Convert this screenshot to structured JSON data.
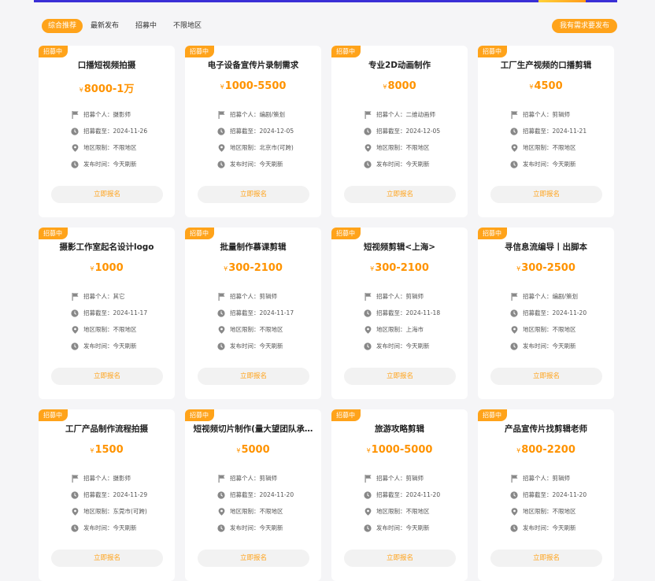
{
  "filters": {
    "tabs": [
      "综合推荐",
      "最新发布",
      "招募中",
      "不限地区"
    ],
    "active_index": 0,
    "publish_button": "我有需求要发布"
  },
  "field_labels": {
    "recruit": "招募个人：",
    "deadline": "招募截至：",
    "region": "地区限制：",
    "published": "发布时间："
  },
  "currency_symbol": "¥",
  "apply_label": "立即报名",
  "cards": [
    {
      "status": "招募中",
      "title": "口播短视频拍摄",
      "price": "8000-1万",
      "recruit": "摄影师",
      "deadline": "2024-11-26",
      "region": "不限地区",
      "published": "今天刷新"
    },
    {
      "status": "招募中",
      "title": "电子设备宣传片录制需求",
      "price": "1000-5500",
      "recruit": "编剧/策划",
      "deadline": "2024-12-05",
      "region": "北京市(可跨)",
      "published": "今天刷新"
    },
    {
      "status": "招募中",
      "title": "专业2D动画制作",
      "price": "8000",
      "recruit": "二维动画师",
      "deadline": "2024-12-05",
      "region": "不限地区",
      "published": "今天刷新"
    },
    {
      "status": "招募中",
      "title": "工厂生产视频的口播剪辑",
      "price": "4500",
      "recruit": "剪辑师",
      "deadline": "2024-11-21",
      "region": "不限地区",
      "published": "今天刷新"
    },
    {
      "status": "招募中",
      "title": "摄影工作室起名设计logo",
      "price": "1000",
      "recruit": "其它",
      "deadline": "2024-11-17",
      "region": "不限地区",
      "published": "今天刷新"
    },
    {
      "status": "招募中",
      "title": "批量制作慕课剪辑",
      "price": "300-2100",
      "recruit": "剪辑师",
      "deadline": "2024-11-17",
      "region": "不限地区",
      "published": "今天刷新"
    },
    {
      "status": "招募中",
      "title": "短视频剪辑<上海>",
      "price": "300-2100",
      "recruit": "剪辑师",
      "deadline": "2024-11-18",
      "region": "上海市",
      "published": "今天刷新"
    },
    {
      "status": "招募中",
      "title": "寻信息流编导丨出脚本",
      "price": "300-2500",
      "recruit": "编剧/策划",
      "deadline": "2024-11-20",
      "region": "不限地区",
      "published": "今天刷新"
    },
    {
      "status": "招募中",
      "title": "工厂产品制作流程拍摄",
      "price": "1500",
      "recruit": "摄影师",
      "deadline": "2024-11-29",
      "region": "东莞市(可跨)",
      "published": "今天刷新"
    },
    {
      "status": "招募中",
      "title": "短视频切片制作(量大望团队承…",
      "price": "5000",
      "recruit": "剪辑师",
      "deadline": "2024-11-20",
      "region": "不限地区",
      "published": "今天刷新"
    },
    {
      "status": "招募中",
      "title": "旅游攻略剪辑",
      "price": "1000-5000",
      "recruit": "剪辑师",
      "deadline": "2024-11-20",
      "region": "不限地区",
      "published": "今天刷新"
    },
    {
      "status": "招募中",
      "title": "产品宣传片找剪辑老师",
      "price": "800-2200",
      "recruit": "剪辑师",
      "deadline": "2024-11-20",
      "region": "不限地区",
      "published": "今天刷新"
    }
  ],
  "colors": {
    "accent": "#ffa31a",
    "price": "#ff9300",
    "banner": "#3a2fd6"
  }
}
